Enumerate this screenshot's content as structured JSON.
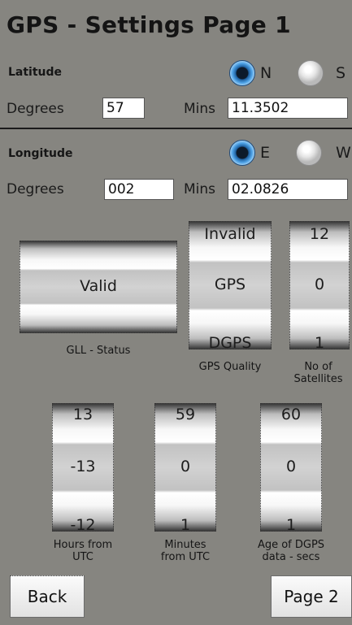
{
  "title": "GPS - Settings Page 1",
  "latitude": {
    "label": "Latitude",
    "hemisphere_options": [
      {
        "letter": "N",
        "selected": true
      },
      {
        "letter": "S",
        "selected": false
      }
    ],
    "degrees_label": "Degrees",
    "degrees_value": "57",
    "mins_label": "Mins",
    "mins_value": "11.3502"
  },
  "longitude": {
    "label": "Longitude",
    "hemisphere_options": [
      {
        "letter": "E",
        "selected": true
      },
      {
        "letter": "W",
        "selected": false
      }
    ],
    "degrees_label": "Degrees",
    "degrees_value": "002",
    "mins_label": "Mins",
    "mins_value": "02.0826"
  },
  "gll_status": {
    "current": "Valid",
    "caption": "GLL - Status"
  },
  "gps_quality": {
    "above": "Invalid",
    "current": "GPS",
    "below": "DGPS",
    "caption": "GPS Quality"
  },
  "satellites": {
    "above": "12",
    "current": "0",
    "below": "1",
    "caption_line1": "No of",
    "caption_line2": "Satellites"
  },
  "hours_utc": {
    "above": "13",
    "current": "-13",
    "below": "-12",
    "caption_line1": "Hours from",
    "caption_line2": "UTC"
  },
  "minutes_utc": {
    "above": "59",
    "current": "0",
    "below": "1",
    "caption_line1": "Minutes",
    "caption_line2": "from UTC"
  },
  "dgps_age": {
    "above": "60",
    "current": "0",
    "below": "1",
    "caption_line1": "Age of DGPS",
    "caption_line2": "data - secs"
  },
  "buttons": {
    "back": "Back",
    "next": "Page 2"
  },
  "colors": {
    "background": "#868580",
    "radio_selected": "#3a7fc0"
  }
}
